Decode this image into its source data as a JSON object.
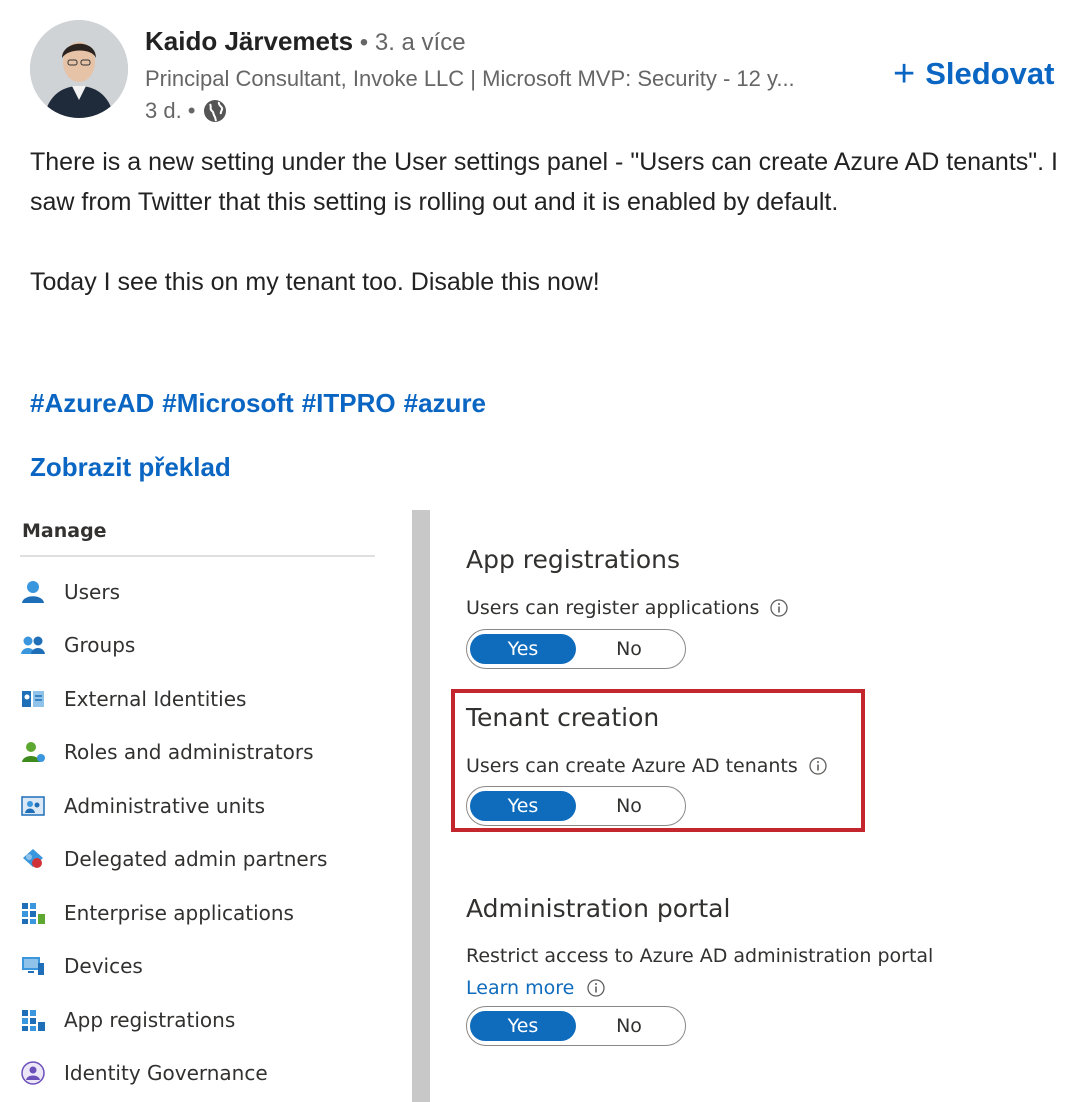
{
  "author": {
    "name": "Kaido Järvemets",
    "degree": " • 3. a více",
    "headline": "Principal Consultant, Invoke LLC | Microsoft MVP: Security - 12 y...",
    "time": "3 d. •"
  },
  "follow": {
    "plus": "+",
    "label": "Sledovat"
  },
  "post": {
    "paragraph1": "There is a new setting under the User settings panel - \"Users can create Azure AD tenants\". I saw from Twitter that this setting is rolling out and it is enabled by default.",
    "paragraph2": "Today I see this on my tenant too. Disable this now!",
    "hashtags": [
      "#AzureAD",
      "#Microsoft",
      "#ITPRO",
      "#azure"
    ],
    "translate": "Zobrazit překlad"
  },
  "azure": {
    "manage_title": "Manage",
    "nav": [
      {
        "label": "Users",
        "icon": "user-icon"
      },
      {
        "label": "Groups",
        "icon": "groups-icon"
      },
      {
        "label": "External Identities",
        "icon": "external-identities-icon"
      },
      {
        "label": "Roles and administrators",
        "icon": "roles-icon"
      },
      {
        "label": "Administrative units",
        "icon": "admin-units-icon"
      },
      {
        "label": "Delegated admin partners",
        "icon": "delegated-partners-icon"
      },
      {
        "label": "Enterprise applications",
        "icon": "enterprise-apps-icon"
      },
      {
        "label": "Devices",
        "icon": "devices-icon"
      },
      {
        "label": "App registrations",
        "icon": "app-registrations-icon"
      },
      {
        "label": "Identity Governance",
        "icon": "identity-governance-icon"
      }
    ],
    "sections": {
      "app_registrations": {
        "title": "App registrations",
        "label": "Users can register applications",
        "yes": "Yes",
        "no": "No",
        "selected": "Yes"
      },
      "tenant_creation": {
        "title": "Tenant creation",
        "label": "Users can create Azure AD tenants",
        "yes": "Yes",
        "no": "No",
        "selected": "Yes"
      },
      "admin_portal": {
        "title": "Administration portal",
        "label": "Restrict access to Azure AD administration portal",
        "learn_more": "Learn more",
        "yes": "Yes",
        "no": "No",
        "selected": "Yes"
      }
    },
    "colors": {
      "accent": "#0f6cbd",
      "highlight": "#c4262e",
      "linkedin_blue": "#0a66c2"
    }
  }
}
